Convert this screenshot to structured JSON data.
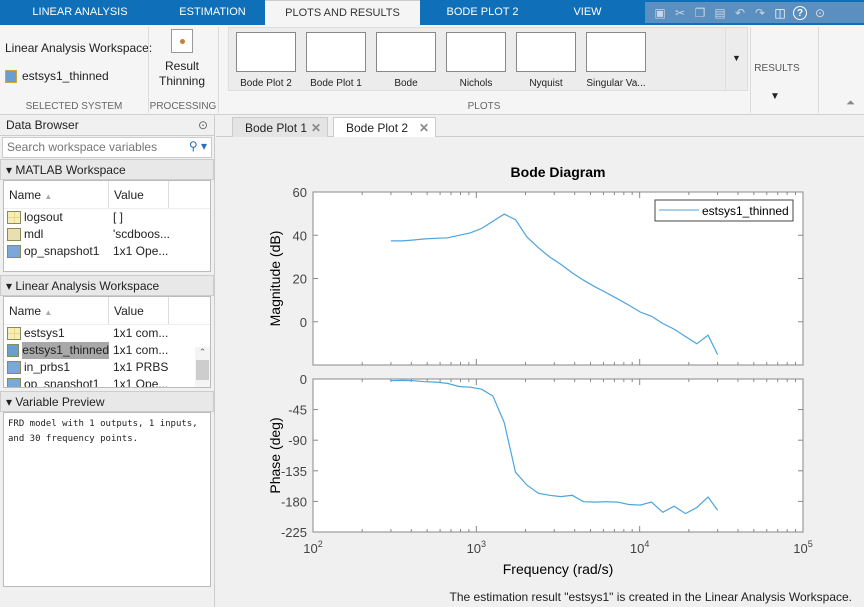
{
  "ribbon_tabs": [
    "LINEAR ANALYSIS",
    "ESTIMATION",
    "PLOTS AND RESULTS",
    "BODE PLOT 2",
    "VIEW"
  ],
  "active_tab": "PLOTS AND RESULTS",
  "quick_access_icons": [
    "save-icon",
    "cut-icon",
    "copy-icon",
    "paste-icon",
    "undo-icon",
    "redo-icon",
    "switch-windows-icon",
    "help-icon",
    "menu-icon"
  ],
  "ribbon": {
    "workspace_label": "Linear Analysis Workspace:",
    "selected_system": "estsys1_thinned",
    "selected_system_section": "SELECTED SYSTEM",
    "result_thinning": "Result Thinning",
    "processing_section": "PROCESSING",
    "plots": [
      "Bode Plot 2",
      "Bode Plot 1",
      "Bode",
      "Nichols",
      "Nyquist",
      "Singular Va..."
    ],
    "plots_section": "PLOTS",
    "results_section": "RESULTS"
  },
  "data_browser": {
    "title": "Data Browser",
    "search_placeholder": "Search workspace variables",
    "matlab_ws": {
      "title": "MATLAB Workspace",
      "col_name": "Name",
      "col_value": "Value",
      "rows": [
        {
          "name": "logsout",
          "value": "[ ]"
        },
        {
          "name": "mdl",
          "value": "'scdboos..."
        },
        {
          "name": "op_snapshot1",
          "value": "1x1 Ope..."
        }
      ]
    },
    "linear_ws": {
      "title": "Linear Analysis Workspace",
      "col_name": "Name",
      "col_value": "Value",
      "rows": [
        {
          "name": "estsys1",
          "value": "1x1 com..."
        },
        {
          "name": "estsys1_thinned",
          "value": "1x1 com..."
        },
        {
          "name": "in_prbs1",
          "value": "1x1 PRBS"
        },
        {
          "name": "op_snapshot1",
          "value": "1x1 Ope..."
        }
      ]
    },
    "preview": {
      "title": "Variable Preview",
      "text": "FRD model with 1 outputs, 1 inputs,\nand 30 frequency points."
    }
  },
  "doc_tabs": [
    "Bode Plot 1",
    "Bode Plot 2"
  ],
  "active_doc_tab": "Bode Plot 2",
  "status": "The estimation result \"estsys1\" is created in the Linear Analysis Workspace.",
  "chart_data": {
    "type": "line",
    "title": "Bode Diagram",
    "xlabel": "Frequency  (rad/s)",
    "xscale": "log",
    "xlim": [
      100,
      100000
    ],
    "xticks": [
      "10^2",
      "10^3",
      "10^4",
      "10^5"
    ],
    "grid": false,
    "legend": {
      "entries": [
        "estsys1_thinned"
      ],
      "placement": "top-right"
    },
    "color": "#4da3dc",
    "x": [
      300,
      352,
      413,
      484,
      568,
      667,
      782,
      917,
      1076,
      1263,
      1481,
      1738,
      2039,
      2392,
      2806,
      3292,
      3862,
      4531,
      5315,
      6236,
      7316,
      8583,
      10070,
      11813,
      13859,
      16259,
      19075,
      22379,
      26254,
      30000
    ],
    "magnitude": {
      "ylabel": "Magnitude (dB)",
      "ylim": [
        -20,
        60
      ],
      "yticks": [
        60,
        40,
        20,
        0
      ],
      "series": [
        {
          "name": "estsys1_thinned",
          "values": [
            37.4,
            37.4,
            37.8,
            38.3,
            38.6,
            38.8,
            40.0,
            41.1,
            43.1,
            46.5,
            49.8,
            47.2,
            39.2,
            34.3,
            30.0,
            26.5,
            22.6,
            19.2,
            16.2,
            13.5,
            10.6,
            7.7,
            4.5,
            2.5,
            -0.8,
            -3.4,
            -6.8,
            -10.2,
            -6.2,
            -15.2
          ]
        }
      ]
    },
    "phase": {
      "ylabel": "Phase (deg)",
      "ylim": [
        -225,
        0
      ],
      "yticks": [
        0,
        -45,
        -90,
        -135,
        -180,
        -225
      ],
      "series": [
        {
          "name": "estsys1_thinned",
          "values": [
            -2.5,
            -2,
            -2.5,
            -4,
            -4.5,
            -6.5,
            -11,
            -12,
            -15,
            -25,
            -64,
            -137,
            -156,
            -168,
            -171,
            -173,
            -171,
            -180.5,
            -181,
            -180.5,
            -181,
            -184.5,
            -185.5,
            -181,
            -196,
            -187,
            -198,
            -189,
            -173.5,
            -193
          ]
        }
      ]
    }
  }
}
